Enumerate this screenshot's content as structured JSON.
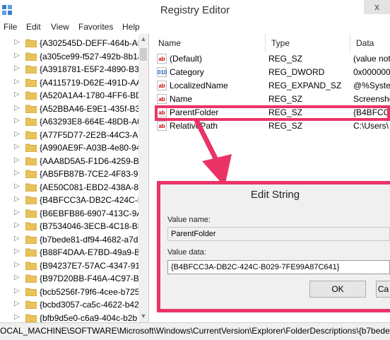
{
  "window": {
    "title": "Registry Editor",
    "close_glyph": "x"
  },
  "menu": [
    "File",
    "Edit",
    "View",
    "Favorites",
    "Help"
  ],
  "tree": {
    "items": [
      "{A302545D-DEFF-464b-AB",
      "{a305ce99-f527-492b-8b1a",
      "{A3918781-E5F2-4890-B3D",
      "{A4115719-D62E-491D-AA",
      "{A520A1A4-1780-4FF6-BD",
      "{A52BBA46-E9E1-435f-B3D",
      "{A63293E8-664E-48DB-A07",
      "{A77F5D77-2E2B-44C3-A6",
      "{A990AE9F-A03B-4e80-94",
      "{AAA8D5A5-F1D6-4259-BA",
      "{AB5FB87B-7CE2-4F83-915",
      "{AE50C081-EBD2-438A-86",
      "{B4BFCC3A-DB2C-424C-B",
      "{B6EBFB86-6907-413C-9AF",
      "{B7534046-3ECB-4C18-BE4",
      "{b7bede81-df94-4682-a7d",
      "{B88F4DAA-E7BD-49a9-B7",
      "{B94237E7-57AC-4347-915",
      "{B97D20BB-F46A-4C97-BA",
      "{bcb5256f-79f6-4cee-b725",
      "{bcbd3057-ca5c-4622-b42",
      "{bfb9d5e0-c6a9-404c-b2b"
    ]
  },
  "columns": {
    "name": "Name",
    "type": "Type",
    "data": "Data"
  },
  "values": [
    {
      "icon": "ab",
      "name": "(Default)",
      "type": "REG_SZ",
      "data": "(value not"
    },
    {
      "icon": "bin",
      "name": "Category",
      "type": "REG_DWORD",
      "data": "0x0000000"
    },
    {
      "icon": "ab",
      "name": "LocalizedName",
      "type": "REG_EXPAND_SZ",
      "data": "@%Syster"
    },
    {
      "icon": "ab",
      "name": "Name",
      "type": "REG_SZ",
      "data": "Screensho"
    },
    {
      "icon": "ab",
      "name": "ParentFolder",
      "type": "REG_SZ",
      "data": "{B4BFCC3"
    },
    {
      "icon": "ab",
      "name": "RelativePath",
      "type": "REG_SZ",
      "data": "C:\\Users\\"
    }
  ],
  "icons": {
    "ab": "ab",
    "bin": "010"
  },
  "dialog": {
    "title": "Edit String",
    "value_name_label": "Value name:",
    "value_name": "ParentFolder",
    "value_data_label": "Value data:",
    "value_data": "{B4BFCC3A-DB2C-424C-B029-7FE99A87C641}",
    "ok_label": "OK",
    "cancel_label": "Ca"
  },
  "status_path": "OCAL_MACHINE\\SOFTWARE\\Microsoft\\Windows\\CurrentVersion\\Explorer\\FolderDescriptions\\{b7bede81",
  "colors": {
    "annotation": "#ea3468",
    "folder": "#e8c25a",
    "folder_edge": "#c99a2e"
  }
}
